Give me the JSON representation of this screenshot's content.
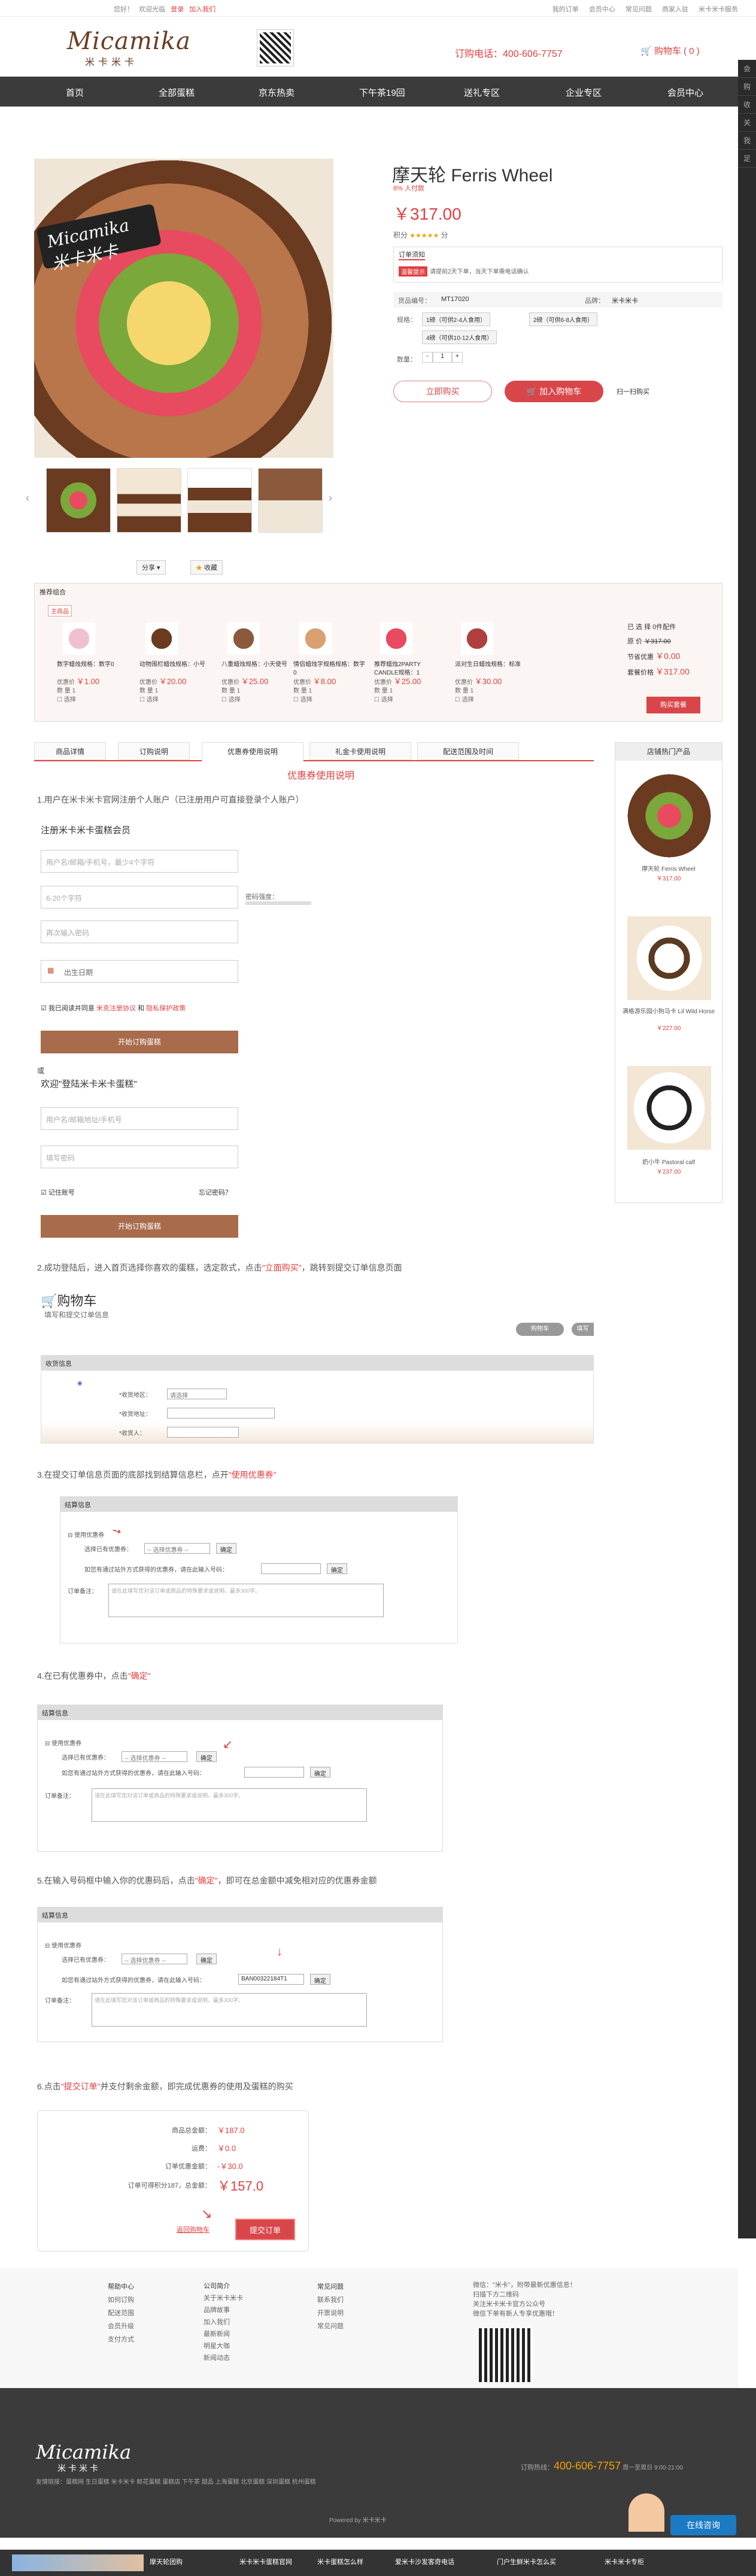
{
  "topbar": {
    "left": [
      "您好！",
      "欢迎光临",
      "登录",
      "加入我们"
    ],
    "right": [
      "我的订单",
      "会员中心",
      "常见问题",
      "商家入驻",
      "米卡米卡服务"
    ]
  },
  "header": {
    "logo_en": "Micamika",
    "logo_cn": "米卡米卡",
    "hotline": "订购电话：400-606-7757",
    "cart": "购物车 ( 0 )"
  },
  "nav": [
    "首页",
    "全部蛋糕",
    "京东热卖",
    "下午茶19回",
    "送礼专区",
    "企业专区",
    "会员中心"
  ],
  "sidebar": [
    "会",
    "员",
    "购",
    "物",
    "车",
    "收",
    "藏",
    "关",
    "注",
    "我",
    "的",
    "足",
    "迹"
  ],
  "product": {
    "badge": "Micamika 米卡米卡",
    "title": "摩天轮 Ferris Wheel",
    "subtitle": "8% 人付款",
    "price": "￥317.00",
    "rating_label": "积分",
    "rating_value": "分",
    "rating_stars": "★★★★★",
    "service_label": "订单须知",
    "service_tag": "温馨提示",
    "service_text": "请提前2天下单，当天下单需电话确认",
    "code_label": "货品编号：",
    "code_value": "MT17020",
    "brand_label": "品牌：",
    "brand_value": "米卡米卡",
    "spec_label": "规格：",
    "spec1": "1磅（可供2-4人食用）",
    "spec2": "2磅（可供6-8人食用）",
    "spec3": "4磅（可供10-12人食用）",
    "qty_label": "数量：",
    "qty": "1",
    "buy_now": "立即购买",
    "add_cart": "加入购物车",
    "scan": "扫一扫购买",
    "share": "分享",
    "fav": "收藏"
  },
  "combo": {
    "title": "推荐组合",
    "tab": "主商品",
    "items": [
      {
        "name": "数字蜡烛规格：数字0",
        "price": "￥1.00",
        "price_label": "优惠价",
        "qty_label": "数 量",
        "qty": "1",
        "check": "选择"
      },
      {
        "name": "动物围栏蜡烛规格：小号",
        "price": "￥20.00",
        "price_label": "优惠价",
        "qty_label": "数 量",
        "qty": "1",
        "check": "选择"
      },
      {
        "name": "八重蜡烛规格：小天使号",
        "price": "￥25.00",
        "price_label": "优惠价",
        "qty_label": "数 量",
        "qty": "1",
        "check": "选择"
      },
      {
        "name": "情侣蜡烛字规格规格：数字0",
        "price": "￥8.00",
        "price_label": "优惠价",
        "qty_label": "数 量",
        "qty": "1",
        "check": "选择"
      },
      {
        "name": "推荐蜡烛2PARTY CANDLE规格：1",
        "price": "￥25.00",
        "price_label": "优惠价",
        "qty_label": "数 量",
        "qty": "1",
        "check": "选择"
      },
      {
        "name": "派对生日蜡烛规格：标准",
        "price": "￥30.00",
        "price_label": "优惠价",
        "qty_label": "数 量",
        "qty": "1",
        "check": "选择"
      }
    ],
    "summary_count": "已 选 择 0件配件",
    "summary_orig_label": "原 价",
    "summary_orig": "￥317.00",
    "summary_save_label": "节省优惠",
    "summary_save": "￥0.00",
    "summary_total_label": "套餐价格",
    "summary_total": "￥317.00",
    "buy": "购买套餐"
  },
  "tabs": [
    "商品详情",
    "订购说明",
    "优惠券使用说明",
    "礼金卡使用说明",
    "配送范围及时间"
  ],
  "section_title": "优惠券使用说明",
  "hot": {
    "title": "店铺热门产品",
    "items": [
      {
        "name": "摩天轮 Ferris Wheel",
        "price": "￥317.00"
      },
      {
        "name": "满格游乐园小狗马卡 Lil Wild Horse",
        "price": "￥227.00"
      },
      {
        "name": "奶小牛 Pastoral calf",
        "price": "￥237.00"
      }
    ]
  },
  "steps": {
    "s1": "1.用户在米卡米卡官网注册个人账户（已注册用户可直接登录个人账户）",
    "reg_title": "注册米卡米卡蛋糕会员",
    "reg_phone": "用户名/邮箱/手机号，最少4个字符",
    "reg_pwd": "6-20个字符",
    "reg_pwd_strength": "密码强度：",
    "reg_pwd2": "再次输入密码",
    "reg_birthday": "出生日期",
    "reg_agree": "我已阅读并同意",
    "reg_link1": "米克注册协议",
    "reg_and": "和",
    "reg_link2": "隐私保护政策",
    "reg_btn": "开始订购蛋糕",
    "or": "或",
    "login_title": "欢迎\"登陆米卡米卡蛋糕\"",
    "login_user": "用户名/邮箱地址/手机号",
    "login_pwd": "填写密码",
    "login_remember": "记住账号",
    "login_forgot": "忘记密码？",
    "login_btn": "开始订购蛋糕",
    "s2_pre": "2.成功登陆后，进入首页选择你喜欢的蛋糕，选定款式，点击",
    "s2_em": "\"立面购买\"",
    "s2_post": "，跳转到提交订单信息页面",
    "cart_title": "购物车",
    "cart_sub": "填写和提交订单信息",
    "cart_btn1": "购物车",
    "cart_btn2": "填写",
    "ship_head": "收货信息",
    "ship_region": "*收货地区：",
    "ship_region_val": "请选择",
    "ship_addr": "*收货地址：",
    "ship_name": "*收货人：",
    "s3_pre": "3.在提交订单信息页面的底部找到结算信息栏，点开",
    "s3_em": "\"使用优惠券\"",
    "pay_head": "结算信息",
    "use_coupon": "使用优惠券",
    "choose_coupon": "选择已有优惠券：",
    "choose_val": "-- 选择优惠券 --",
    "confirm": "确定",
    "other_code": "如您有通过站外方式获得的优惠券，请在此输入号码：",
    "note_label": "订单备注：",
    "note_ph": "请在此填写您对该订单或商品的特殊要求或说明，最多300字。",
    "s4_pre": "4.在已有优惠券中，点击",
    "s4_em": "\"确定\"",
    "s5_pre": "5.在输入号码框中输入你的优惠码后，点击",
    "s5_em": "\"确定\"",
    "s5_post": "，即可在总金额中减免相对应的优惠券金额",
    "coupon_code": "BAN00322184T1",
    "s6_pre": "6.点击",
    "s6_em": "\"提交订单\"",
    "s6_post": "并支付剩余金额，即完成优惠券的使用及蛋糕的购买",
    "sum_goods_label": "商品总金额：",
    "sum_goods": "￥187.0",
    "sum_ship_label": "运费：",
    "sum_ship": "￥0.0",
    "sum_coupon_label": "订单优惠金额：",
    "sum_coupon": "-￥30.0",
    "sum_total_label": "订单可得积分187，总金额：",
    "sum_total": "￥157.0",
    "back_cart": "返回购物车",
    "submit": "提交订单"
  },
  "footer": {
    "cols": [
      {
        "title": "帮助中心",
        "items": [
          "如何订购",
          "配送范围",
          "会员升级",
          "支付方式"
        ]
      },
      {
        "title": "公司简介",
        "items": [
          "关于米卡米卡",
          "品牌故事",
          "加入我们",
          "最新新闻",
          "明星大咖",
          "新闻动态"
        ]
      },
      {
        "title": "常见问题",
        "items": [
          "联系我们",
          "开票说明",
          "常见问题"
        ]
      }
    ],
    "wechat": "微信：\"米卡\"，附带最新优惠信息！",
    "wechat2": "扫描下方二维码",
    "wechat3": "关注米卡米卡官方公众号",
    "wechat4": "微信下单有新人专享优惠哦！",
    "phone": "400-606-7757",
    "phone_label": "订购热线：",
    "hours": "周一至周日 9:00-21:00",
    "links": "友情链接：蛋糕网 生日蛋糕 米卡米卡 鲜花蛋糕 蛋糕店 下午茶 甜品 上海蛋糕 北京蛋糕 深圳蛋糕 杭州蛋糕",
    "copyright": "Powered by 米卡米卡",
    "chat": "在线咨询"
  },
  "bottombar": [
    "摩天轮团购",
    "米卡米卡蛋糕官网",
    "米卡蛋糕怎么样",
    "爱米卡沙发客奇电话",
    "门户生鲜米卡怎么买",
    "米卡米卡专柜"
  ]
}
